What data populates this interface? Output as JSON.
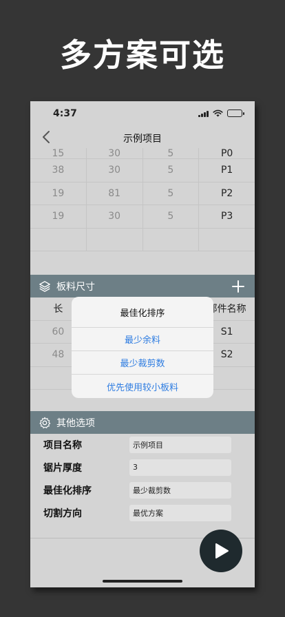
{
  "headline": "多方案可选",
  "status": {
    "time": "4:37"
  },
  "nav": {
    "title": "示例项目"
  },
  "parts_table": {
    "rows": [
      [
        "15",
        "30",
        "5",
        "P0"
      ],
      [
        "38",
        "30",
        "5",
        "P1"
      ],
      [
        "19",
        "81",
        "5",
        "P2"
      ],
      [
        "19",
        "30",
        "5",
        "P3"
      ],
      [
        "",
        "",
        "",
        ""
      ]
    ]
  },
  "boards_section": {
    "title": "板料尺寸",
    "headers": [
      "长",
      "",
      "",
      "部件名称"
    ],
    "rows": [
      [
        "60",
        "",
        "",
        "S1"
      ],
      [
        "48",
        "",
        "",
        "S2"
      ],
      [
        "",
        "",
        "",
        ""
      ]
    ]
  },
  "options_section": {
    "title": "其他选项",
    "fields": [
      {
        "label": "项目名称",
        "value": "示例项目"
      },
      {
        "label": "锯片厚度",
        "value": "3"
      },
      {
        "label": "最佳化排序",
        "value": "最少裁剪数"
      },
      {
        "label": "切割方向",
        "value": "最优方案"
      }
    ]
  },
  "action_sheet": {
    "title": "最佳化排序",
    "actions": [
      "最少余料",
      "最少裁剪数",
      "优先使用较小板料"
    ]
  },
  "icons": {
    "back": "chevron-left-icon",
    "boards": "layers-icon",
    "add": "plus-icon",
    "options": "gear-icon",
    "run": "play-icon",
    "wifi": "wifi-icon",
    "battery": "battery-icon",
    "signal": "signal-icon"
  },
  "colors": {
    "background": "#353535",
    "section_bar": "#6d7f86",
    "action_link": "#2f7de1",
    "fab": "#1f2a2e"
  }
}
